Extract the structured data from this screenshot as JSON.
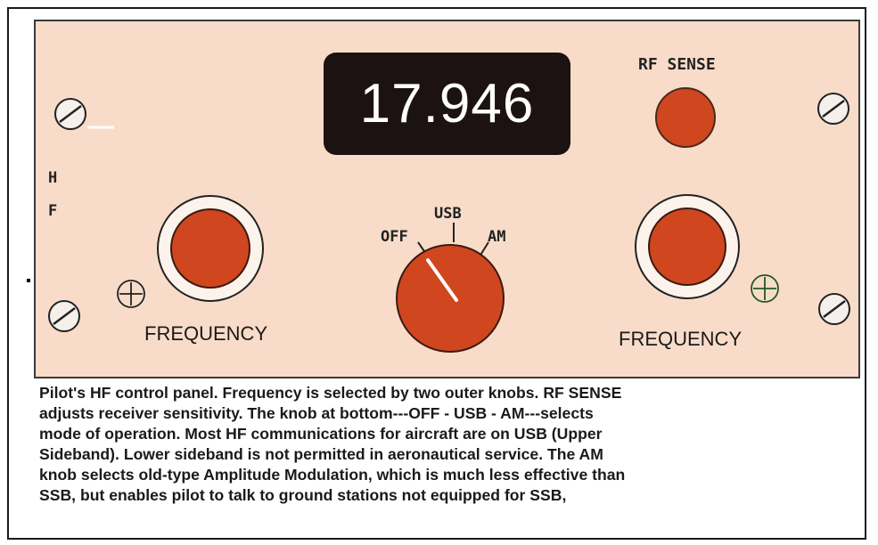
{
  "panel": {
    "display_value": "17.946",
    "rf_sense_label": "RF SENSE",
    "side_label_h": "H",
    "side_label_f": "F",
    "left_knob_label": "FREQUENCY",
    "right_knob_label": "FREQUENCY",
    "mode_knob": {
      "positions": [
        "OFF",
        "USB",
        "AM"
      ],
      "selected": "OFF"
    },
    "colors": {
      "panel": "#f8dcc9",
      "knob": "#d0461f",
      "display_bg": "#1c1212",
      "display_text": "#ffffff"
    },
    "icons": [
      "screw-icon",
      "plus-icon"
    ]
  },
  "caption": {
    "lines": [
      "Pilot's HF control panel.  Frequency is  selected by two outer knobs.  RF SENSE",
      "adjusts receiver sensitivity.  The knob  at bottom---OFF - USB - AM---selects",
      "mode of operation.  Most HF communications for aircraft are on USB (Upper",
      "Sideband). Lower sideband is not permitted in aeronautical service.  The AM",
      "knob selects  old-type Amplitude Modulation, which is much less effective than",
      "SSB, but enables pilot to talk to ground stations not equipped for SSB,"
    ]
  }
}
